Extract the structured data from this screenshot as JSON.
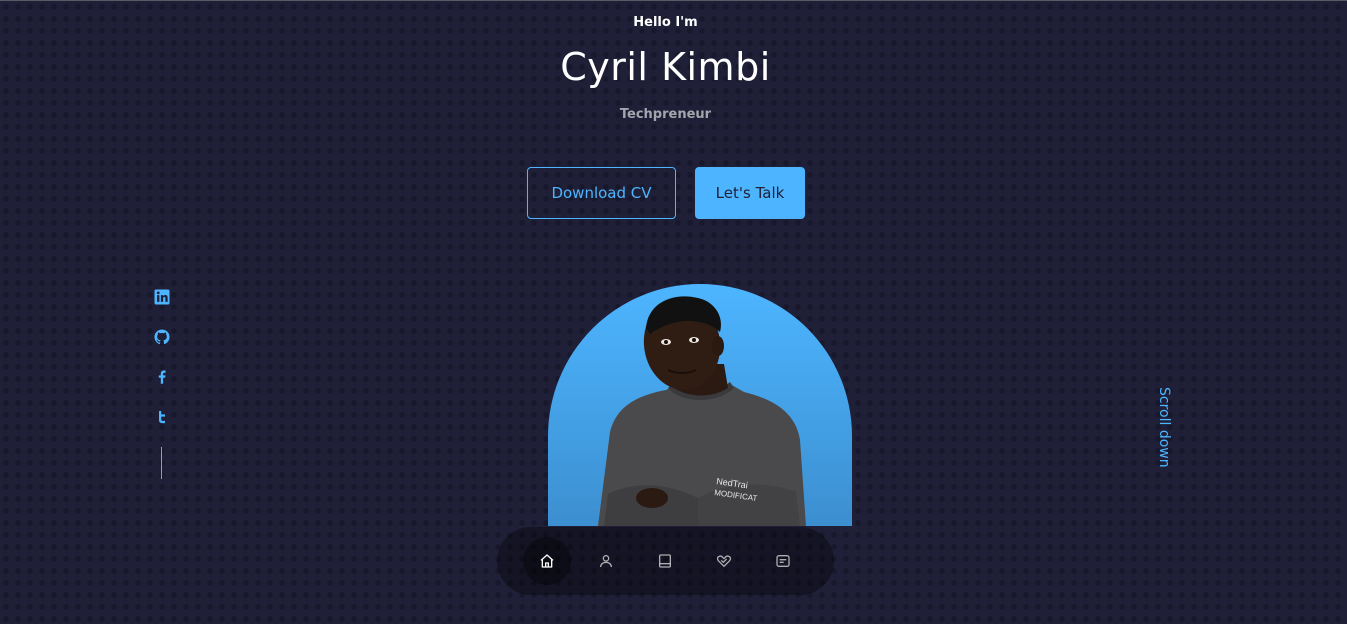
{
  "header": {
    "greeting": "Hello I'm",
    "name": "Cyril Kimbi",
    "role": "Techpreneur"
  },
  "cta": {
    "download_label": "Download CV",
    "talk_label": "Let's Talk"
  },
  "socials": [
    {
      "icon": "linkedin-icon"
    },
    {
      "icon": "github-icon"
    },
    {
      "icon": "facebook-icon"
    },
    {
      "icon": "twitter-icon"
    }
  ],
  "scroll_label": "Scroll down",
  "nav": {
    "items": [
      {
        "icon": "home-icon",
        "active": true
      },
      {
        "icon": "user-icon",
        "active": false
      },
      {
        "icon": "book-icon",
        "active": false
      },
      {
        "icon": "services-icon",
        "active": false
      },
      {
        "icon": "message-icon",
        "active": false
      }
    ]
  },
  "colors": {
    "background": "#1f1f38",
    "accent": "#4db5ff",
    "text": "#ffffff"
  }
}
